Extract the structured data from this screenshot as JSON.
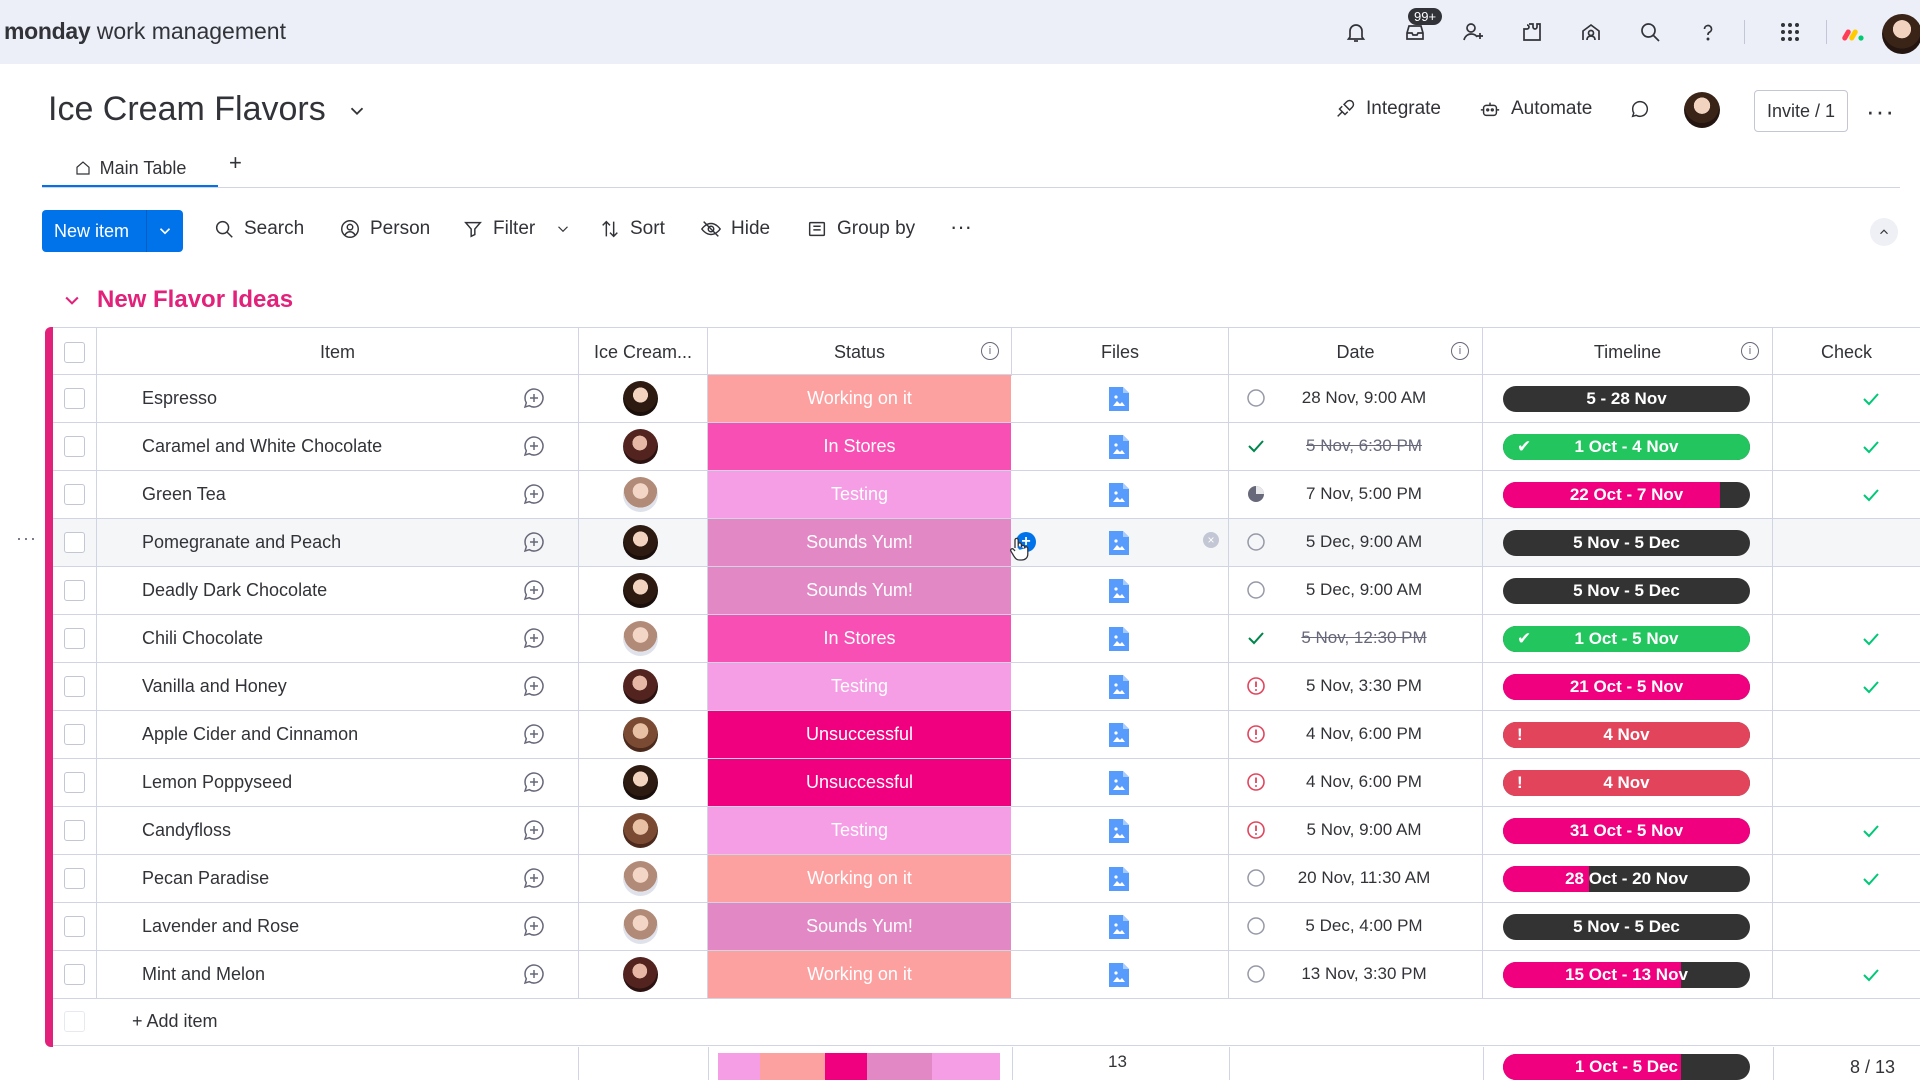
{
  "app": {
    "brand_bold": "monday",
    "brand_rest": " work management",
    "notifications_badge": "99+"
  },
  "board": {
    "title": "Ice Cream Flavors",
    "actions": {
      "integrate": "Integrate",
      "automate": "Automate",
      "invite": "Invite / 1"
    },
    "tabs": [
      {
        "label": "Main Table"
      }
    ],
    "add_tab": "+"
  },
  "toolbar": {
    "new_item": "New item",
    "search": "Search",
    "person": "Person",
    "filter": "Filter",
    "sort": "Sort",
    "hide": "Hide",
    "group_by": "Group by"
  },
  "group": {
    "title": "New Flavor Ideas",
    "color": "#e2217a"
  },
  "columns": {
    "item": "Item",
    "owner": "Ice Cream...",
    "status": "Status",
    "files": "Files",
    "date": "Date",
    "timeline": "Timeline",
    "check": "Check"
  },
  "status_colors": {
    "Working on it": "#fca0a0",
    "In Stores": "#f74fb3",
    "Testing": "#f59de5",
    "Sounds Yum!": "#e288c4",
    "Unsuccessful": "#f0007f"
  },
  "rows": [
    {
      "name": "Espresso",
      "avatar": "a",
      "status": "Working on it",
      "date_icon": "circle",
      "date": "28 Nov, 9:00 AM",
      "strike": false,
      "timeline": "5 - 28 Nov",
      "tl_fill": 0,
      "tl_color": "#333333",
      "tl_lead": "",
      "check": true
    },
    {
      "name": "Caramel and White Chocolate",
      "avatar": "b",
      "status": "In Stores",
      "date_icon": "done",
      "date": "5 Nov, 6:30 PM",
      "strike": true,
      "timeline": "1 Oct - 4 Nov",
      "tl_fill": 1,
      "tl_color": "#22c55e",
      "tl_lead": "✔",
      "check": true
    },
    {
      "name": "Green Tea",
      "avatar": "c",
      "status": "Testing",
      "date_icon": "half",
      "date": "7 Nov, 5:00 PM",
      "strike": false,
      "timeline": "22 Oct - 7 Nov",
      "tl_fill": 0.88,
      "tl_color": "#f0007f",
      "tl_lead": "",
      "check": true
    },
    {
      "name": "Pomegranate and Peach",
      "avatar": "a",
      "status": "Sounds Yum!",
      "date_icon": "circle",
      "date": "5 Dec, 9:00 AM",
      "strike": false,
      "timeline": "5 Nov - 5 Dec",
      "tl_fill": 0,
      "tl_color": "#333333",
      "tl_lead": "",
      "check": false
    },
    {
      "name": "Deadly Dark Chocolate",
      "avatar": "a",
      "status": "Sounds Yum!",
      "date_icon": "circle",
      "date": "5 Dec, 9:00 AM",
      "strike": false,
      "timeline": "5 Nov - 5 Dec",
      "tl_fill": 0,
      "tl_color": "#333333",
      "tl_lead": "",
      "check": false
    },
    {
      "name": "Chili Chocolate",
      "avatar": "c",
      "status": "In Stores",
      "date_icon": "done",
      "date": "5 Nov, 12:30 PM",
      "strike": true,
      "timeline": "1 Oct - 5 Nov",
      "tl_fill": 1,
      "tl_color": "#22c55e",
      "tl_lead": "✔",
      "check": true
    },
    {
      "name": "Vanilla and Honey",
      "avatar": "b",
      "status": "Testing",
      "date_icon": "alert",
      "date": "5 Nov, 3:30 PM",
      "strike": false,
      "timeline": "21 Oct - 5 Nov",
      "tl_fill": 1,
      "tl_color": "#f0007f",
      "tl_lead": "",
      "check": true
    },
    {
      "name": "Apple Cider and Cinnamon",
      "avatar": "d",
      "status": "Unsuccessful",
      "date_icon": "alert",
      "date": "4 Nov, 6:00 PM",
      "strike": false,
      "timeline": "4 Nov",
      "tl_fill": 1,
      "tl_color": "#e2445c",
      "tl_lead": "!",
      "check": false
    },
    {
      "name": "Lemon Poppyseed",
      "avatar": "a",
      "status": "Unsuccessful",
      "date_icon": "alert",
      "date": "4 Nov, 6:00 PM",
      "strike": false,
      "timeline": "4 Nov",
      "tl_fill": 1,
      "tl_color": "#e2445c",
      "tl_lead": "!",
      "check": false
    },
    {
      "name": "Candyfloss",
      "avatar": "d",
      "status": "Testing",
      "date_icon": "alert",
      "date": "5 Nov, 9:00 AM",
      "strike": false,
      "timeline": "31 Oct - 5 Nov",
      "tl_fill": 1,
      "tl_color": "#f0007f",
      "tl_lead": "",
      "check": true
    },
    {
      "name": "Pecan Paradise",
      "avatar": "c",
      "status": "Working on it",
      "date_icon": "circle",
      "date": "20 Nov, 11:30 AM",
      "strike": false,
      "timeline": "28 Oct - 20 Nov",
      "tl_fill": 0.35,
      "tl_color": "#f0007f",
      "tl_lead": "",
      "check": true
    },
    {
      "name": "Lavender and Rose",
      "avatar": "c",
      "status": "Sounds Yum!",
      "date_icon": "circle",
      "date": "5 Dec, 4:00 PM",
      "strike": false,
      "timeline": "5 Nov - 5 Dec",
      "tl_fill": 0,
      "tl_color": "#333333",
      "tl_lead": "",
      "check": false
    },
    {
      "name": "Mint and Melon",
      "avatar": "b",
      "status": "Working on it",
      "date_icon": "circle",
      "date": "13 Nov, 3:30 PM",
      "strike": false,
      "timeline": "15 Oct - 13 Nov",
      "tl_fill": 0.72,
      "tl_color": "#f0007f",
      "tl_lead": "",
      "check": true
    }
  ],
  "add_item": "+ Add item",
  "summary": {
    "status_segments": [
      {
        "color": "#f59de5",
        "share": 0.15
      },
      {
        "color": "#fca0a0",
        "share": 0.23
      },
      {
        "color": "#f0007f",
        "share": 0.15
      },
      {
        "color": "#e288c4",
        "share": 0.23
      },
      {
        "color": "#f59de5",
        "share": 0.24
      }
    ],
    "files_count": "13",
    "timeline": "1 Oct - 5 Dec",
    "timeline_fill": 0.72,
    "check_count": "8 / 13"
  }
}
